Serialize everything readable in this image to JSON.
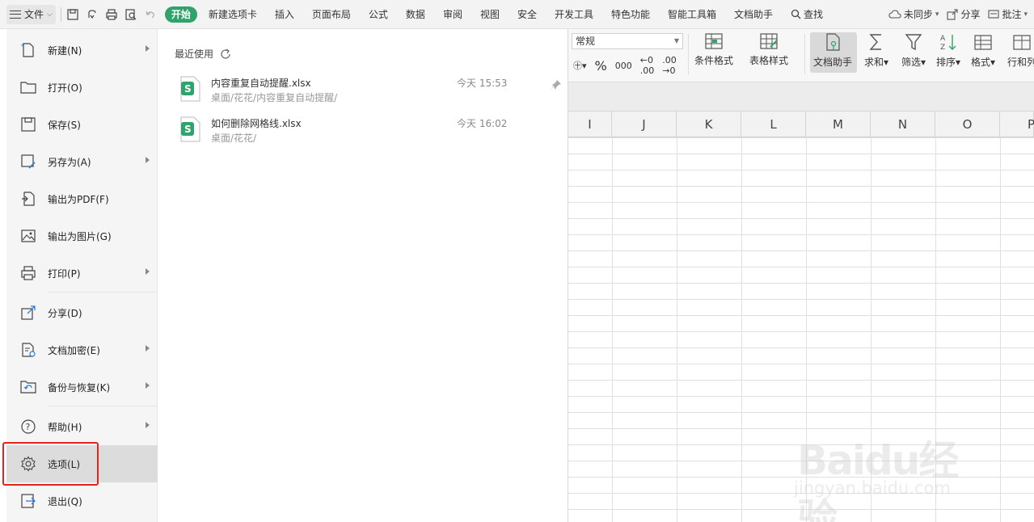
{
  "topbar": {
    "file_label": "文件",
    "tabs": [
      "开始",
      "新建选项卡",
      "插入",
      "页面布局",
      "公式",
      "数据",
      "审阅",
      "视图",
      "安全",
      "开发工具",
      "特色功能",
      "智能工具箱",
      "文档助手"
    ],
    "active_tab": "开始",
    "search_label": "查找",
    "sync_label": "未同步",
    "share_label": "分享",
    "comment_label": "批注"
  },
  "ribbon": {
    "number_format": "常规",
    "percent_symbol": "%",
    "thousands_symbol": "000",
    "conditional_format": "条件格式",
    "table_style": "表格样式",
    "doc_assistant": "文档助手",
    "sum": "求和",
    "filter": "筛选",
    "sort": "排序",
    "format": "格式",
    "rows_cols": "行和列"
  },
  "sheet": {
    "columns": [
      "I",
      "J",
      "K",
      "L",
      "M",
      "N",
      "O",
      "P"
    ]
  },
  "file_menu": {
    "items": [
      {
        "label": "新建(N)",
        "icon": "new-file-icon",
        "has_submenu": true
      },
      {
        "label": "打开(O)",
        "icon": "folder-icon",
        "has_submenu": false
      },
      {
        "label": "保存(S)",
        "icon": "save-icon",
        "has_submenu": false
      },
      {
        "label": "另存为(A)",
        "icon": "save-as-icon",
        "has_submenu": true
      },
      {
        "label": "输出为PDF(F)",
        "icon": "pdf-icon",
        "has_submenu": false
      },
      {
        "label": "输出为图片(G)",
        "icon": "image-icon",
        "has_submenu": false
      },
      {
        "label": "打印(P)",
        "icon": "printer-icon",
        "has_submenu": true
      },
      {
        "label": "分享(D)",
        "icon": "share-icon",
        "has_submenu": false
      },
      {
        "label": "文档加密(E)",
        "icon": "encrypt-icon",
        "has_submenu": true
      },
      {
        "label": "备份与恢复(K)",
        "icon": "backup-icon",
        "has_submenu": true
      },
      {
        "label": "帮助(H)",
        "icon": "help-icon",
        "has_submenu": true
      },
      {
        "label": "选项(L)",
        "icon": "gear-icon",
        "has_submenu": false
      },
      {
        "label": "退出(Q)",
        "icon": "exit-icon",
        "has_submenu": false
      }
    ],
    "selected": "选项(L)"
  },
  "recent": {
    "title": "最近使用",
    "files": [
      {
        "name": "内容重复自动提醒.xlsx",
        "path": "桌面/花花/内容重复自动提醒/",
        "time": "今天 15:53"
      },
      {
        "name": "如何删除网格线.xlsx",
        "path": "桌面/花花/",
        "time": "今天 16:02"
      }
    ]
  },
  "watermark": {
    "brand": "Baidu经验",
    "url": "jingyan.baidu.com"
  }
}
